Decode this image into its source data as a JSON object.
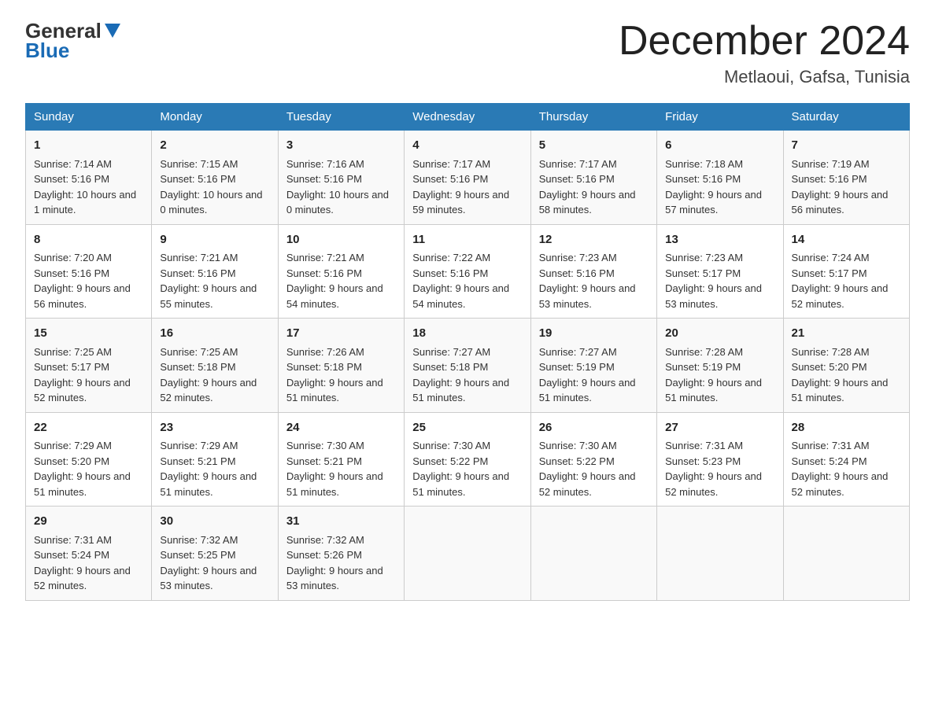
{
  "logo": {
    "general": "General",
    "blue": "Blue"
  },
  "header": {
    "title": "December 2024",
    "location": "Metlaoui, Gafsa, Tunisia"
  },
  "days_of_week": [
    "Sunday",
    "Monday",
    "Tuesday",
    "Wednesday",
    "Thursday",
    "Friday",
    "Saturday"
  ],
  "weeks": [
    [
      {
        "day": "1",
        "sunrise": "7:14 AM",
        "sunset": "5:16 PM",
        "daylight": "10 hours and 1 minute."
      },
      {
        "day": "2",
        "sunrise": "7:15 AM",
        "sunset": "5:16 PM",
        "daylight": "10 hours and 0 minutes."
      },
      {
        "day": "3",
        "sunrise": "7:16 AM",
        "sunset": "5:16 PM",
        "daylight": "10 hours and 0 minutes."
      },
      {
        "day": "4",
        "sunrise": "7:17 AM",
        "sunset": "5:16 PM",
        "daylight": "9 hours and 59 minutes."
      },
      {
        "day": "5",
        "sunrise": "7:17 AM",
        "sunset": "5:16 PM",
        "daylight": "9 hours and 58 minutes."
      },
      {
        "day": "6",
        "sunrise": "7:18 AM",
        "sunset": "5:16 PM",
        "daylight": "9 hours and 57 minutes."
      },
      {
        "day": "7",
        "sunrise": "7:19 AM",
        "sunset": "5:16 PM",
        "daylight": "9 hours and 56 minutes."
      }
    ],
    [
      {
        "day": "8",
        "sunrise": "7:20 AM",
        "sunset": "5:16 PM",
        "daylight": "9 hours and 56 minutes."
      },
      {
        "day": "9",
        "sunrise": "7:21 AM",
        "sunset": "5:16 PM",
        "daylight": "9 hours and 55 minutes."
      },
      {
        "day": "10",
        "sunrise": "7:21 AM",
        "sunset": "5:16 PM",
        "daylight": "9 hours and 54 minutes."
      },
      {
        "day": "11",
        "sunrise": "7:22 AM",
        "sunset": "5:16 PM",
        "daylight": "9 hours and 54 minutes."
      },
      {
        "day": "12",
        "sunrise": "7:23 AM",
        "sunset": "5:16 PM",
        "daylight": "9 hours and 53 minutes."
      },
      {
        "day": "13",
        "sunrise": "7:23 AM",
        "sunset": "5:17 PM",
        "daylight": "9 hours and 53 minutes."
      },
      {
        "day": "14",
        "sunrise": "7:24 AM",
        "sunset": "5:17 PM",
        "daylight": "9 hours and 52 minutes."
      }
    ],
    [
      {
        "day": "15",
        "sunrise": "7:25 AM",
        "sunset": "5:17 PM",
        "daylight": "9 hours and 52 minutes."
      },
      {
        "day": "16",
        "sunrise": "7:25 AM",
        "sunset": "5:18 PM",
        "daylight": "9 hours and 52 minutes."
      },
      {
        "day": "17",
        "sunrise": "7:26 AM",
        "sunset": "5:18 PM",
        "daylight": "9 hours and 51 minutes."
      },
      {
        "day": "18",
        "sunrise": "7:27 AM",
        "sunset": "5:18 PM",
        "daylight": "9 hours and 51 minutes."
      },
      {
        "day": "19",
        "sunrise": "7:27 AM",
        "sunset": "5:19 PM",
        "daylight": "9 hours and 51 minutes."
      },
      {
        "day": "20",
        "sunrise": "7:28 AM",
        "sunset": "5:19 PM",
        "daylight": "9 hours and 51 minutes."
      },
      {
        "day": "21",
        "sunrise": "7:28 AM",
        "sunset": "5:20 PM",
        "daylight": "9 hours and 51 minutes."
      }
    ],
    [
      {
        "day": "22",
        "sunrise": "7:29 AM",
        "sunset": "5:20 PM",
        "daylight": "9 hours and 51 minutes."
      },
      {
        "day": "23",
        "sunrise": "7:29 AM",
        "sunset": "5:21 PM",
        "daylight": "9 hours and 51 minutes."
      },
      {
        "day": "24",
        "sunrise": "7:30 AM",
        "sunset": "5:21 PM",
        "daylight": "9 hours and 51 minutes."
      },
      {
        "day": "25",
        "sunrise": "7:30 AM",
        "sunset": "5:22 PM",
        "daylight": "9 hours and 51 minutes."
      },
      {
        "day": "26",
        "sunrise": "7:30 AM",
        "sunset": "5:22 PM",
        "daylight": "9 hours and 52 minutes."
      },
      {
        "day": "27",
        "sunrise": "7:31 AM",
        "sunset": "5:23 PM",
        "daylight": "9 hours and 52 minutes."
      },
      {
        "day": "28",
        "sunrise": "7:31 AM",
        "sunset": "5:24 PM",
        "daylight": "9 hours and 52 minutes."
      }
    ],
    [
      {
        "day": "29",
        "sunrise": "7:31 AM",
        "sunset": "5:24 PM",
        "daylight": "9 hours and 52 minutes."
      },
      {
        "day": "30",
        "sunrise": "7:32 AM",
        "sunset": "5:25 PM",
        "daylight": "9 hours and 53 minutes."
      },
      {
        "day": "31",
        "sunrise": "7:32 AM",
        "sunset": "5:26 PM",
        "daylight": "9 hours and 53 minutes."
      },
      null,
      null,
      null,
      null
    ]
  ]
}
